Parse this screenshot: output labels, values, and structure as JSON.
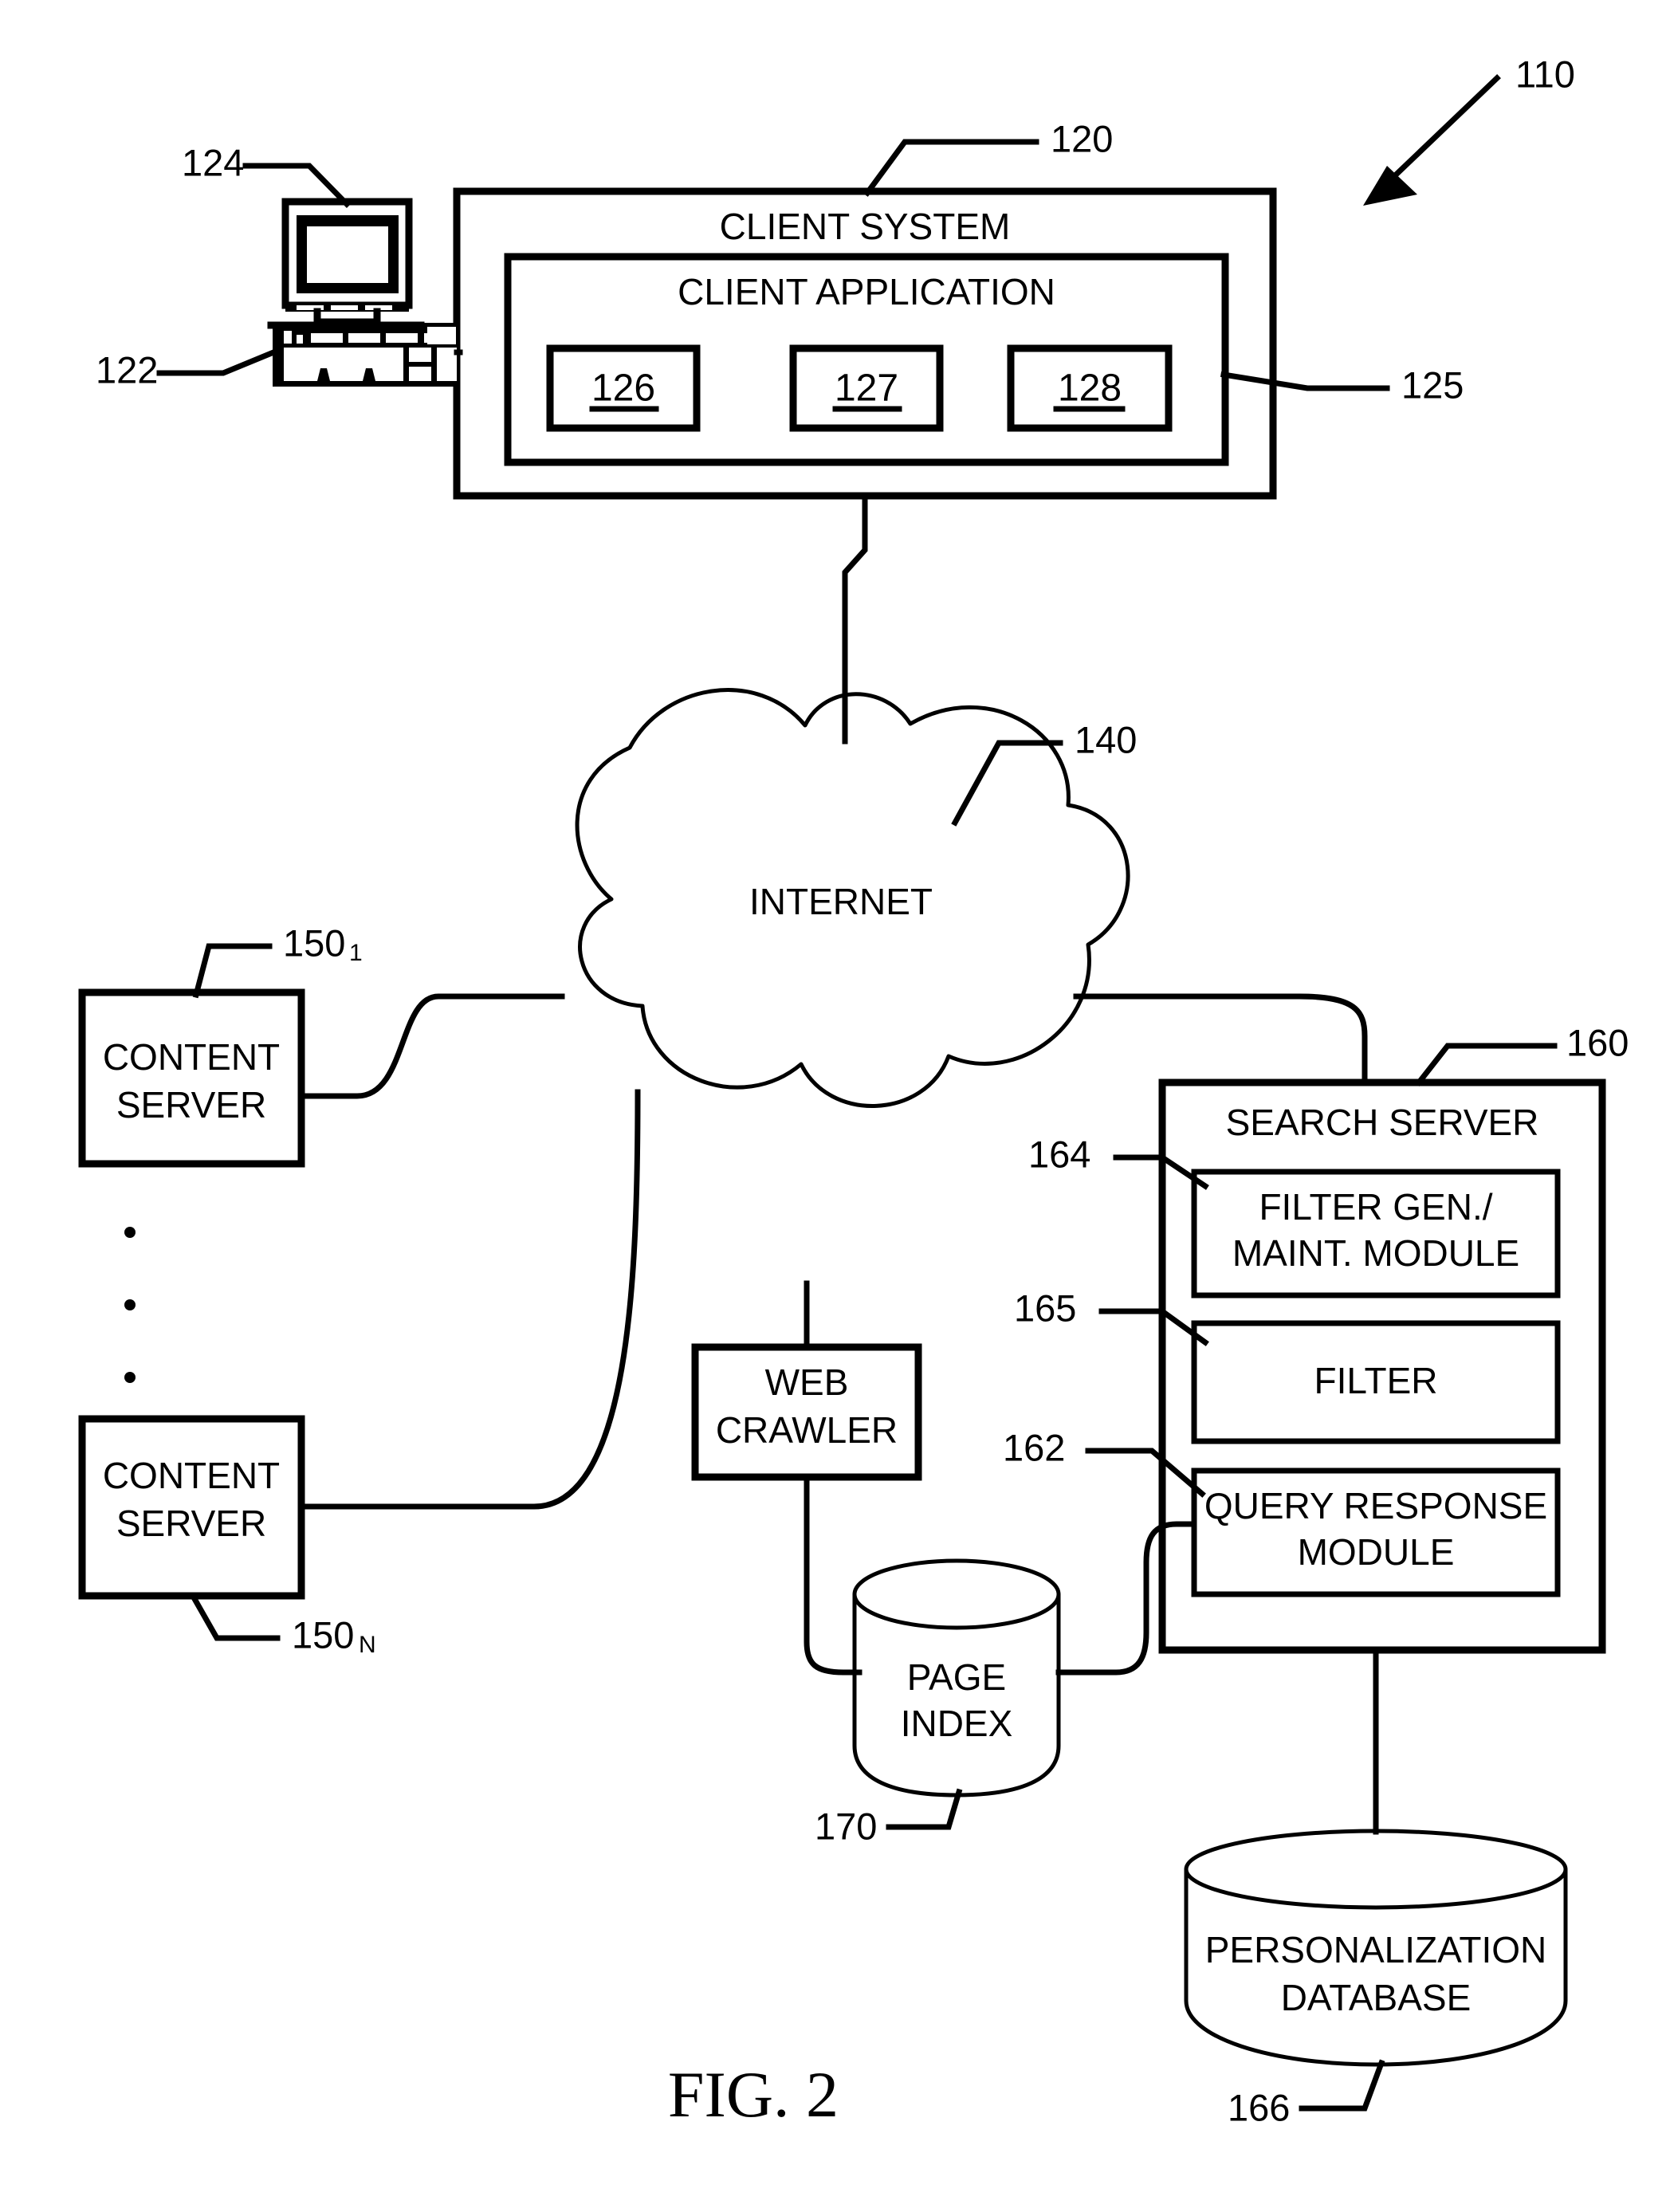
{
  "figure": {
    "caption": "FIG. 2",
    "system_ref": "110"
  },
  "client": {
    "system_label": "CLIENT SYSTEM",
    "system_ref": "120",
    "application_label": "CLIENT APPLICATION",
    "application_ref": "125",
    "monitor_ref": "124",
    "keyboard_ref": "122",
    "modules": [
      {
        "label": "126"
      },
      {
        "label": "127"
      },
      {
        "label": "128"
      }
    ]
  },
  "network": {
    "label": "INTERNET",
    "ref": "140"
  },
  "content_servers": [
    {
      "label_line1": "CONTENT",
      "label_line2": "SERVER",
      "ref": "150",
      "sub": "1"
    },
    {
      "label_line1": "CONTENT",
      "label_line2": "SERVER",
      "ref": "150",
      "sub": "N"
    }
  ],
  "ellipsis_dots": 3,
  "web_crawler": {
    "label_line1": "WEB",
    "label_line2": "CRAWLER"
  },
  "page_index": {
    "label_line1": "PAGE",
    "label_line2": "INDEX",
    "ref": "170"
  },
  "search_server": {
    "label": "SEARCH SERVER",
    "ref": "160",
    "modules": [
      {
        "label_line1": "FILTER GEN./",
        "label_line2": "MAINT. MODULE",
        "ref": "164"
      },
      {
        "label_line1": "FILTER",
        "label_line2": "",
        "ref": "165"
      },
      {
        "label_line1": "QUERY RESPONSE",
        "label_line2": "MODULE",
        "ref": "162"
      }
    ]
  },
  "personalization_db": {
    "label_line1": "PERSONALIZATION",
    "label_line2": "DATABASE",
    "ref": "166"
  },
  "colors": {
    "ink": "#000000",
    "paper": "#ffffff"
  }
}
